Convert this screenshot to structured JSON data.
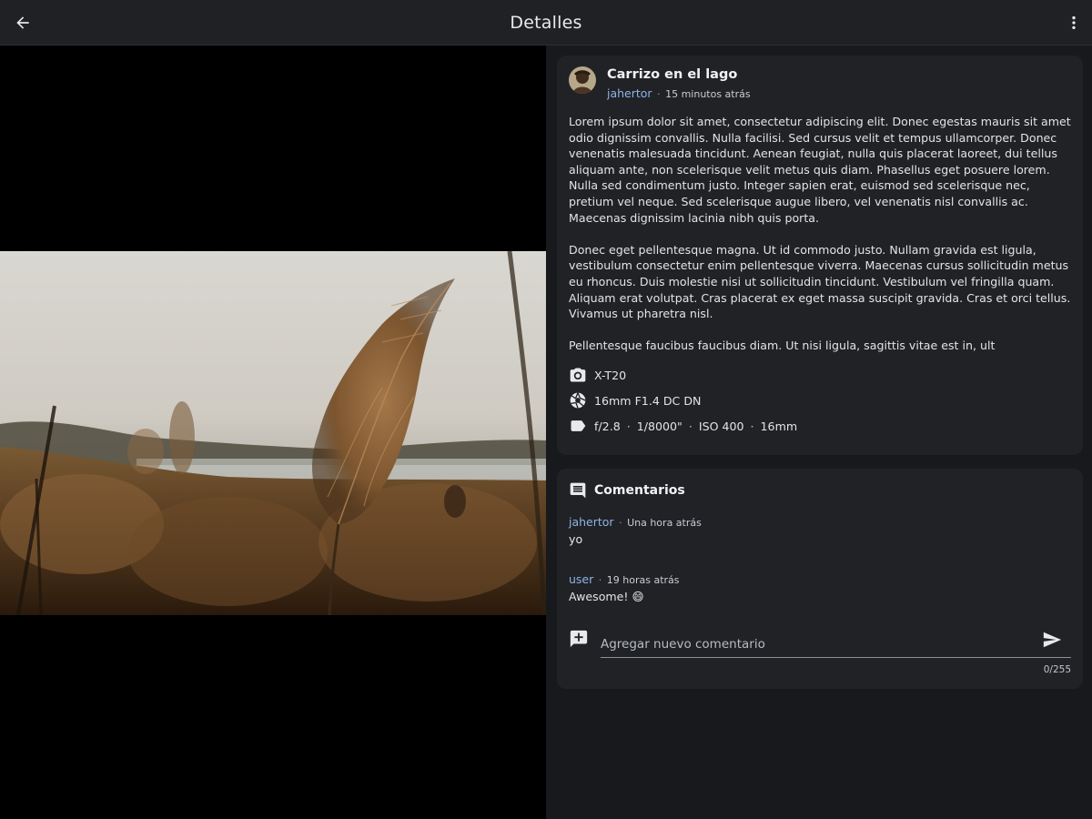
{
  "appbar": {
    "title": "Detalles",
    "back_icon": "arrow-left-icon",
    "menu_icon": "more-vertical-icon"
  },
  "photo": {
    "subject": "reed-plant-lake"
  },
  "post": {
    "title": "Carrizo en el lago",
    "author": "jahertor",
    "time": "15 minutos atrás",
    "paragraphs": [
      "Lorem ipsum dolor sit amet, consectetur adipiscing elit. Donec egestas mauris sit amet odio dignissim convallis. Nulla facilisi. Sed cursus velit et tempus ullamcorper. Donec venenatis malesuada tincidunt. Aenean feugiat, nulla quis placerat laoreet, dui tellus aliquam ante, non scelerisque velit metus quis diam. Phasellus eget posuere lorem. Nulla sed condimentum justo. Integer sapien erat, euismod sed scelerisque nec, pretium vel neque. Sed scelerisque augue libero, vel venenatis nisl convallis ac. Maecenas dignissim lacinia nibh quis porta.",
      "Donec eget pellentesque magna. Ut id commodo justo. Nullam gravida est ligula, vestibulum consectetur enim pellentesque viverra. Maecenas cursus sollicitudin metus eu rhoncus. Duis molestie nisi ut sollicitudin tincidunt. Vestibulum vel fringilla quam. Aliquam erat volutpat. Cras placerat ex eget massa suscipit gravida. Cras et orci tellus. Vivamus ut pharetra nisl.",
      "Pellentesque faucibus faucibus diam. Ut nisi ligula, sagittis vitae est in, ult"
    ],
    "exif": {
      "camera": "X-T20",
      "lens": "16mm F1.4 DC DN",
      "aperture": "f/2.8",
      "shutter": "1/8000\"",
      "iso": "ISO 400",
      "focal": "16mm"
    }
  },
  "comments": {
    "heading": "Comentarios",
    "items": [
      {
        "user": "jahertor",
        "time": "Una hora atrás",
        "text": "yo"
      },
      {
        "user": "user",
        "time": "19 horas atrás",
        "text": "Awesome! 😄"
      }
    ],
    "input": {
      "placeholder": "Agregar nuevo comentario",
      "value": "",
      "counter": "0/255"
    }
  },
  "colors": {
    "background": "#17191c",
    "card": "#202226",
    "appbar": "#1f2124",
    "link": "#8fb2e6"
  }
}
